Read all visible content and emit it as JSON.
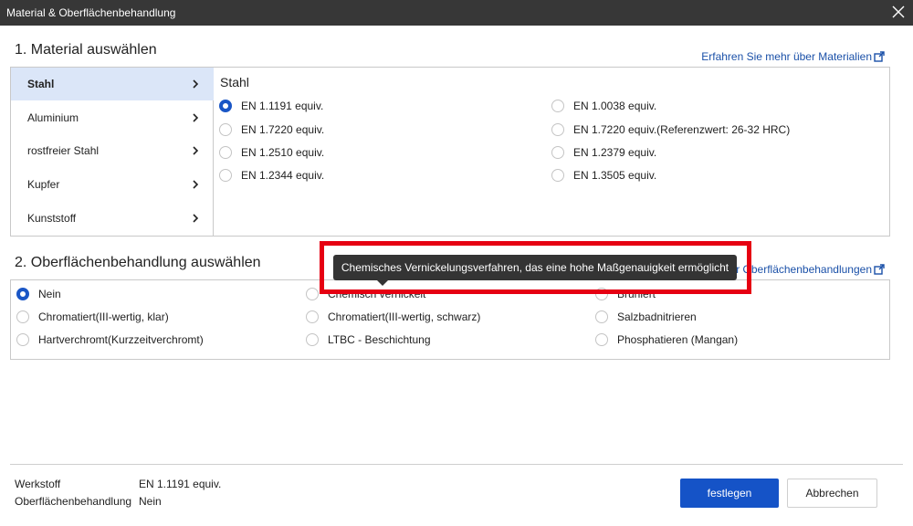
{
  "window": {
    "title": "Material & Oberflächenbehandlung",
    "close_icon": "close-icon"
  },
  "material": {
    "heading": "1. Material auswählen",
    "learn_more": "Erfahren Sie mehr über Materialien",
    "categories": [
      "Stahl",
      "Aluminium",
      "rostfreier Stahl",
      "Kupfer",
      "Kunststoff"
    ],
    "selected_category": "Stahl",
    "panel_title": "Stahl",
    "options_left": [
      "EN 1.1191 equiv.",
      "EN 1.7220 equiv.",
      "EN 1.2510 equiv.",
      "EN 1.2344 equiv."
    ],
    "options_right": [
      "EN 1.0038 equiv.",
      "EN 1.7220 equiv.(Referenzwert: 26-32 HRC)",
      "EN 1.2379 equiv.",
      "EN 1.3505 equiv."
    ],
    "selected_option": "EN 1.1191 equiv."
  },
  "surface": {
    "heading": "2. Oberflächenbehandlung auswählen",
    "learn_more": "er Oberflächenbehandlungen",
    "col1": [
      "Nein",
      "Chromatiert(III-wertig, klar)",
      "Hartverchromt(Kurzzeitverchromt)"
    ],
    "col2": [
      "Chemisch vernickelt",
      "Chromatiert(III-wertig, schwarz)",
      "LTBC - Beschichtung"
    ],
    "col3": [
      "Brüniert",
      "Salzbadnitrieren",
      "Phosphatieren (Mangan)"
    ],
    "selected_option": "Nein",
    "tooltip": "Chemisches Vernickelungsverfahren, das eine hohe Maßgenauigkeit ermöglicht"
  },
  "summary": {
    "material_label": "Werkstoff",
    "material_value": "EN 1.1191 equiv.",
    "surface_label": "Oberflächenbehandlung",
    "surface_value": "Nein"
  },
  "buttons": {
    "confirm": "festlegen",
    "cancel": "Abbrechen"
  },
  "colors": {
    "accent": "#1553c7",
    "highlight": "#e60012",
    "titlebar": "#373737"
  }
}
